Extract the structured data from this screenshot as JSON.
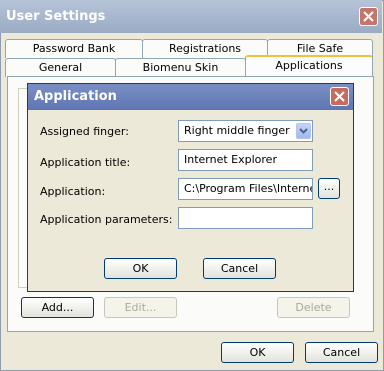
{
  "window": {
    "title": "User Settings",
    "close_icon": "close-icon"
  },
  "tabs": {
    "row1": [
      "Password Bank",
      "Registrations",
      "File Safe"
    ],
    "row2": [
      "General",
      "Biomenu Skin",
      "Applications"
    ],
    "active": "Applications"
  },
  "panel_buttons": {
    "add": "Add...",
    "edit": "Edit...",
    "delete": "Delete"
  },
  "footer": {
    "ok": "OK",
    "cancel": "Cancel"
  },
  "dialog": {
    "title": "Application",
    "close_icon": "close-icon",
    "fields": {
      "assigned_finger_label": "Assigned finger:",
      "assigned_finger_value": "Right middle finger",
      "app_title_label": "Application title:",
      "app_title_value": "Internet Explorer",
      "application_label": "Application:",
      "application_value": "C:\\Program Files\\Internet",
      "browse": "...",
      "params_label": "Application parameters:",
      "params_value": ""
    },
    "ok": "OK",
    "cancel": "Cancel"
  }
}
